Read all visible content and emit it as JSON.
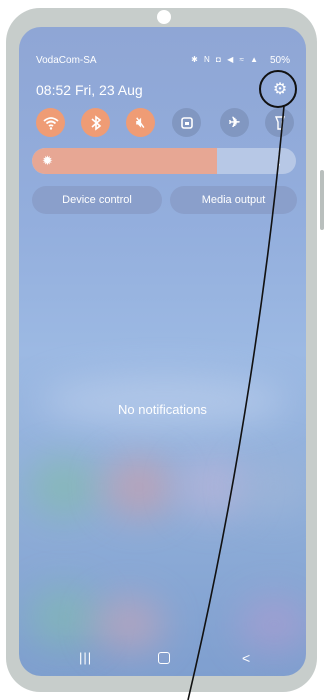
{
  "status_bar": {
    "carrier": "VodaCom-SA",
    "icons": "✱ N ◘ ◀ ≈ ▲",
    "battery": "50%"
  },
  "header": {
    "time": "08:52",
    "date": "Fri, 23 Aug"
  },
  "quick_settings": [
    {
      "name": "wifi",
      "icon": "wifi-icon",
      "state": "on"
    },
    {
      "name": "bluetooth",
      "icon": "bluetooth-icon",
      "state": "on"
    },
    {
      "name": "sound",
      "icon": "mute-icon",
      "state": "on"
    },
    {
      "name": "rotation-lock",
      "icon": "lock-icon",
      "state": "off"
    },
    {
      "name": "airplane-mode",
      "icon": "airplane-icon",
      "state": "off"
    },
    {
      "name": "flashlight",
      "icon": "flashlight-icon",
      "state": "off"
    }
  ],
  "brightness": {
    "level": 0.7
  },
  "buttons": {
    "device_control": "Device control",
    "media_output": "Media output"
  },
  "notifications": {
    "empty_text": "No notifications"
  },
  "colors": {
    "accent_on": "#ef9c75",
    "tile_off": "#8197c1",
    "highlight_ring": "#111111"
  }
}
